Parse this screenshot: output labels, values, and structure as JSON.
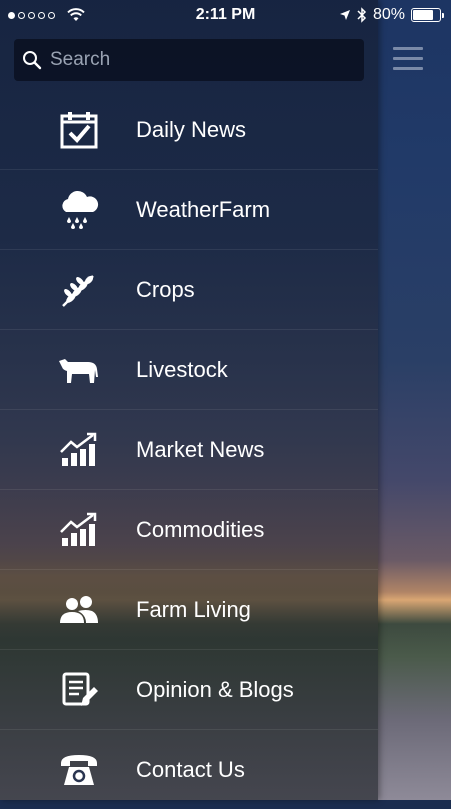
{
  "status": {
    "time": "2:11 PM",
    "battery": "80%",
    "battery_level": 0.8
  },
  "search": {
    "placeholder": "Search"
  },
  "menu": {
    "items": [
      {
        "label": "Daily News",
        "icon": "calendar-check-icon"
      },
      {
        "label": "WeatherFarm",
        "icon": "rain-cloud-icon"
      },
      {
        "label": "Crops",
        "icon": "wheat-icon"
      },
      {
        "label": "Livestock",
        "icon": "cow-icon"
      },
      {
        "label": "Market News",
        "icon": "chart-up-icon"
      },
      {
        "label": "Commodities",
        "icon": "chart-up-icon"
      },
      {
        "label": "Farm Living",
        "icon": "people-icon"
      },
      {
        "label": "Opinion & Blogs",
        "icon": "document-edit-icon"
      },
      {
        "label": "Contact Us",
        "icon": "telephone-icon"
      }
    ]
  }
}
